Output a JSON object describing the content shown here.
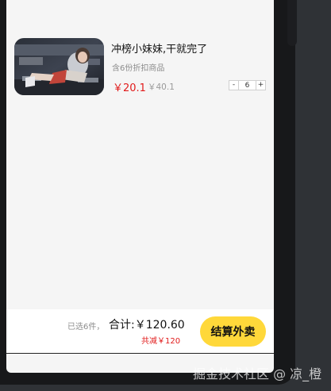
{
  "cart_item": {
    "title": "冲榜小妹妹,干就完了",
    "discount_note": "含6份折扣商品",
    "price_now": "￥20.1",
    "price_original": "￥40.1",
    "quantity": "6",
    "minus": "-",
    "plus": "+"
  },
  "checkout_bar": {
    "selected_count": "已选6件，",
    "total": "合计:￥120.60",
    "reduced": "共减￥120",
    "checkout_label": "结算外卖"
  },
  "watermark": "掘金技术社区 @ 凉_橙",
  "colors": {
    "accent_yellow": "#ffd83a",
    "price_red": "#e11b1b"
  }
}
